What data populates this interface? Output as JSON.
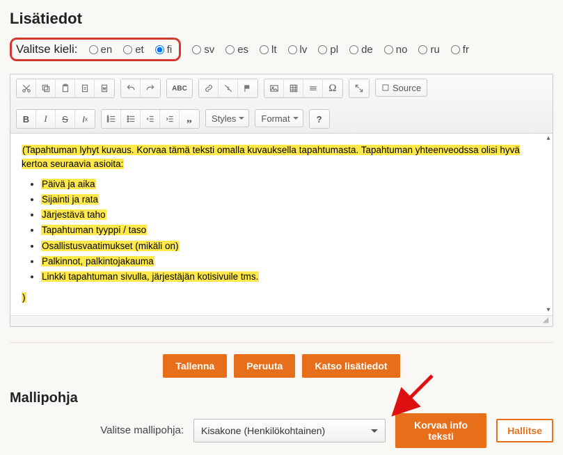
{
  "heading": "Lisätiedot",
  "lang": {
    "label": "Valitse kieli:",
    "options": [
      "en",
      "et",
      "fi",
      "sv",
      "es",
      "lt",
      "lv",
      "pl",
      "de",
      "no",
      "ru",
      "fr"
    ],
    "selected": "fi"
  },
  "toolbar": {
    "styles_label": "Styles",
    "format_label": "Format",
    "source_label": "Source"
  },
  "editor": {
    "intro": "(Tapahtuman lyhyt kuvaus. Korvaa tämä teksti omalla kuvauksella tapahtumasta. Tapahtuman yhteenveodssa olisi hyvä kertoa seuraavia asioita:",
    "bullets": [
      "Päivä ja aika",
      "Sijainti ja rata",
      "Järjestävä taho",
      "Tapahtuman tyyppi / taso",
      "Osallistusvaatimukset (mikäli on)",
      "Palkinnot, palkintojakauma",
      "Linkki tapahtuman sivulla, järjestäjän kotisivuile tms."
    ],
    "close_paren": ")"
  },
  "actions": {
    "save": "Tallenna",
    "cancel": "Peruuta",
    "preview": "Katso lisätiedot"
  },
  "template": {
    "heading": "Mallipohja",
    "select_label": "Valitse mallipohja:",
    "selected": "Kisakone (Henkilökohtainen)",
    "replace_btn": "Korvaa info teksti",
    "manage_btn": "Hallitse"
  }
}
